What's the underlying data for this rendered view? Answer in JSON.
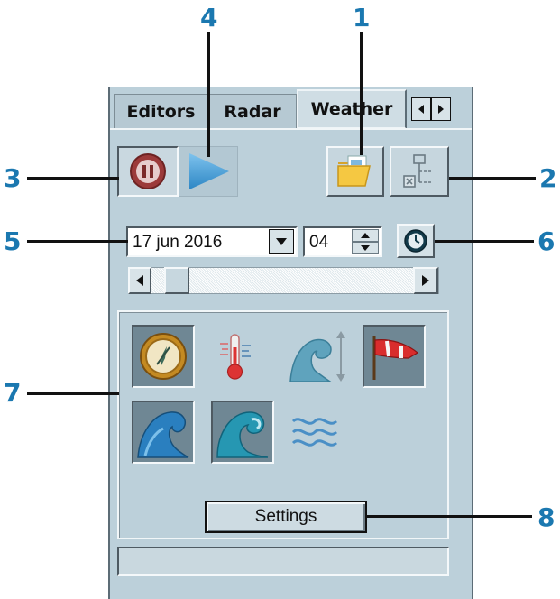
{
  "callouts": [
    "1",
    "2",
    "3",
    "4",
    "5",
    "6",
    "7",
    "8"
  ],
  "tabs": {
    "editors": "Editors",
    "radar": "Radar",
    "weather": "Weather"
  },
  "toolbar": {
    "pause_icon": "pause-icon",
    "play_icon": "play-icon",
    "open_icon": "open-folder-icon",
    "source_icon": "data-source-icon"
  },
  "time": {
    "date": "17 jun 2016",
    "hour": "04",
    "clock_icon": "clock-icon"
  },
  "layers": [
    {
      "icon": "wind-compass-icon",
      "active": true
    },
    {
      "icon": "temperature-icon",
      "active": false
    },
    {
      "icon": "wave-height-icon",
      "active": false
    },
    {
      "icon": "wind-flag-icon",
      "active": true
    },
    {
      "icon": "swell-icon",
      "active": true
    },
    {
      "icon": "wave-icon",
      "active": true
    },
    {
      "icon": "current-icon",
      "active": false
    }
  ],
  "settings_button": "Settings",
  "colors": {
    "callout": "#1b78b0",
    "panel": "#bcd0da",
    "accent_red": "#a83a3a",
    "accent_blue": "#3a8fc8"
  }
}
